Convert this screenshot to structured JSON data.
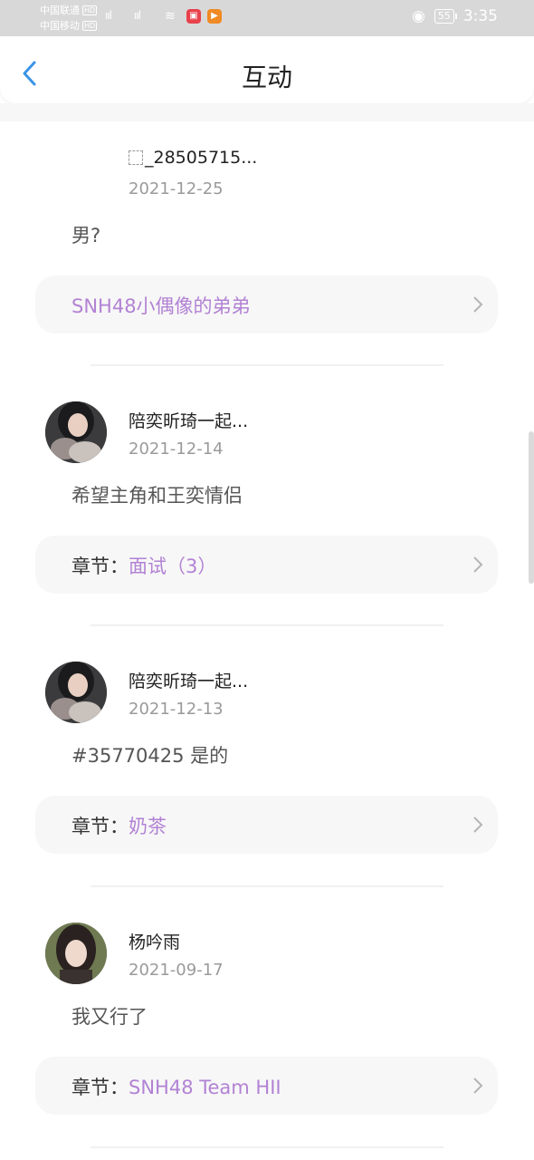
{
  "status_bar": {
    "carrier1": "中国联通",
    "carrier2": "中国移动",
    "hd": "HD",
    "network": "4G",
    "battery": "55",
    "time": "3:35"
  },
  "header": {
    "title": "互动"
  },
  "comments": [
    {
      "username": "_28505715...",
      "date": "2021-12-25",
      "text": "男?",
      "chapter_prefix": "",
      "chapter": "SNH48小偶像的弟弟"
    },
    {
      "username": "陪奕昕琦一起...",
      "date": "2021-12-14",
      "text": "希望主角和王奕情侣",
      "chapter_prefix": "章节：",
      "chapter": "面试（3）"
    },
    {
      "username": "陪奕昕琦一起...",
      "date": "2021-12-13",
      "text": "#35770425 是的",
      "chapter_prefix": "章节：",
      "chapter": "奶茶"
    },
    {
      "username": "杨吟雨",
      "date": "2021-09-17",
      "text": "我又行了",
      "chapter_prefix": "章节：",
      "chapter": "SNH48  Team HII"
    }
  ],
  "colors": {
    "accent": "#b282d4",
    "back_arrow": "#3a95e8"
  }
}
